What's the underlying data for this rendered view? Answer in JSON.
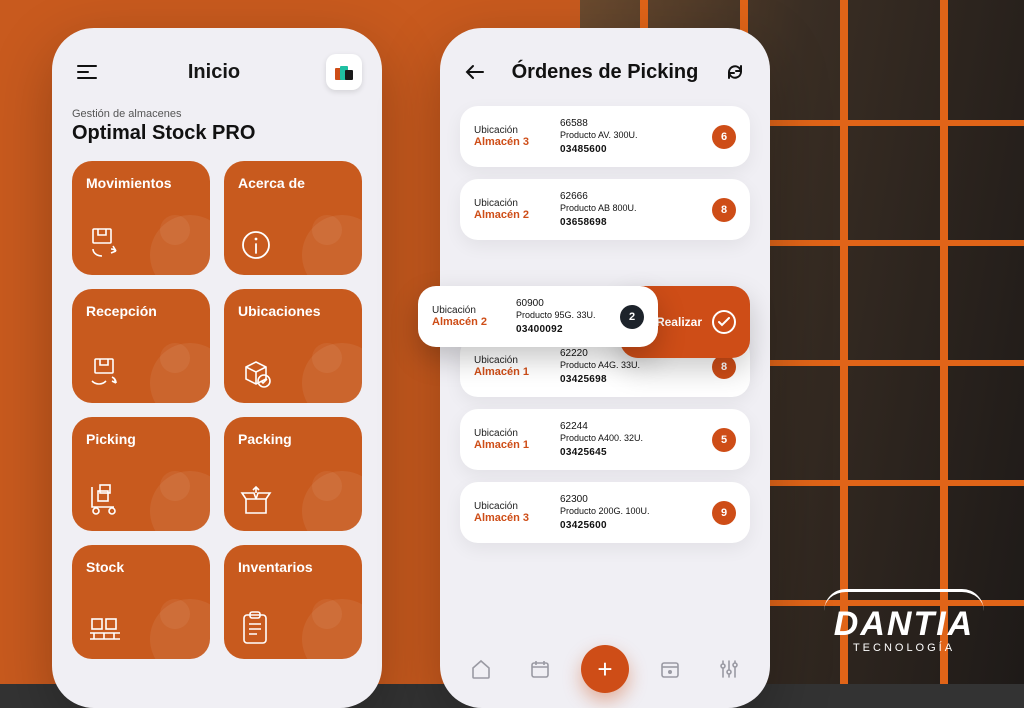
{
  "brand": {
    "name": "DANTIA",
    "sub": "TECNOLOGÍA"
  },
  "left": {
    "header_title": "Inicio",
    "subtitle": "Gestión de almacenes",
    "app_name": "Optimal Stock PRO",
    "tiles": [
      {
        "label": "Movimientos"
      },
      {
        "label": "Acerca de"
      },
      {
        "label": "Recepción"
      },
      {
        "label": "Ubicaciones"
      },
      {
        "label": "Picking"
      },
      {
        "label": "Packing"
      },
      {
        "label": "Stock"
      },
      {
        "label": "Inventarios"
      }
    ]
  },
  "right": {
    "header_title": "Órdenes de Picking",
    "loc_label": "Ubicación",
    "cta_label": "Realizar",
    "orders": [
      {
        "warehouse": "Almacén 3",
        "id": "66588",
        "product": "Producto AV. 300U.",
        "ref": "03485600",
        "count": "6"
      },
      {
        "warehouse": "Almacén 2",
        "id": "62666",
        "product": "Producto AB 800U.",
        "ref": "03658698",
        "count": "8"
      },
      {
        "warehouse": "Almacén 2",
        "id": "60900",
        "product": "Producto 95G. 33U.",
        "ref": "03400092",
        "count": "2",
        "selected": true
      },
      {
        "warehouse": "Almacén 1",
        "id": "62220",
        "product": "Producto A4G. 33U.",
        "ref": "03425698",
        "count": "8"
      },
      {
        "warehouse": "Almacén 1",
        "id": "62244",
        "product": "Producto A400. 32U.",
        "ref": "03425645",
        "count": "5"
      },
      {
        "warehouse": "Almacén 3",
        "id": "62300",
        "product": "Producto 200G. 100U.",
        "ref": "03425600",
        "count": "9"
      }
    ]
  }
}
